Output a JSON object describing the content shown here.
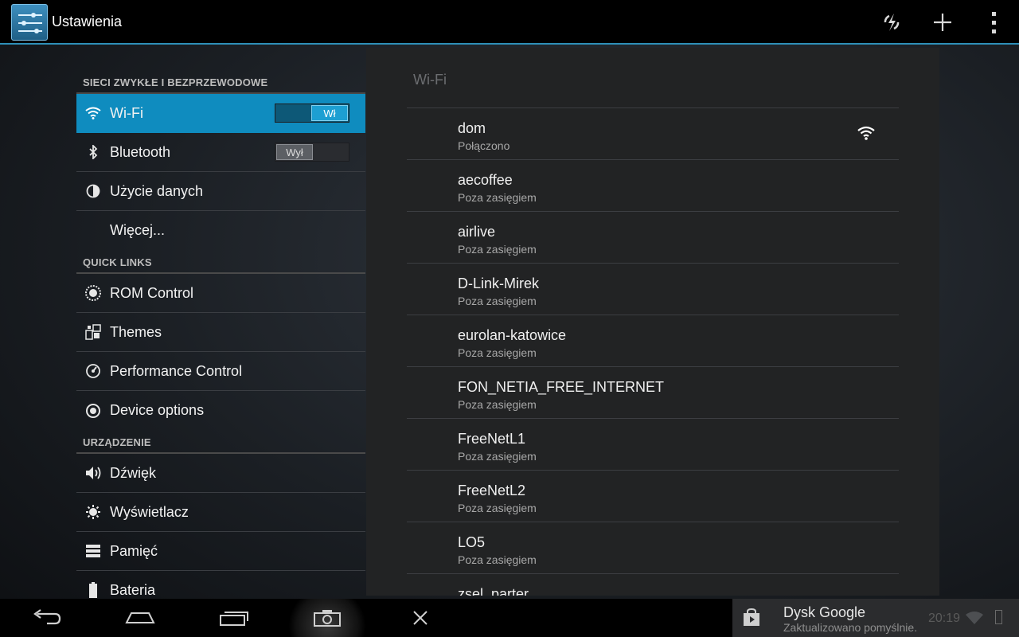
{
  "app": {
    "title": "Ustawienia"
  },
  "actionbar": {
    "refresh_icon": "refresh-icon",
    "add_icon": "add-icon",
    "menu_icon": "overflow-menu-icon"
  },
  "sidebar": {
    "sections": [
      {
        "header": "SIECI ZWYKŁE I BEZPRZEWODOWE",
        "items": [
          {
            "label": "Wi-Fi",
            "icon": "wifi-icon",
            "toggle": "Wł",
            "toggle_state": "on",
            "selected": true
          },
          {
            "label": "Bluetooth",
            "icon": "bluetooth-icon",
            "toggle": "Wył",
            "toggle_state": "off"
          },
          {
            "label": "Użycie danych",
            "icon": "data-usage-icon"
          },
          {
            "label": "Więcej...",
            "icon": ""
          }
        ]
      },
      {
        "header": "QUICK LINKS",
        "items": [
          {
            "label": "ROM Control",
            "icon": "rom-control-icon"
          },
          {
            "label": "Themes",
            "icon": "themes-icon"
          },
          {
            "label": "Performance Control",
            "icon": "performance-icon"
          },
          {
            "label": "Device options",
            "icon": "device-options-icon"
          }
        ]
      },
      {
        "header": "URZĄDZENIE",
        "items": [
          {
            "label": "Dźwięk",
            "icon": "sound-icon"
          },
          {
            "label": "Wyświetlacz",
            "icon": "display-icon"
          },
          {
            "label": "Pamięć",
            "icon": "storage-icon"
          },
          {
            "label": "Bateria",
            "icon": "battery-icon"
          }
        ]
      }
    ]
  },
  "wifi_panel": {
    "title": "Wi-Fi",
    "networks": [
      {
        "name": "dom",
        "status": "Połączono",
        "signal": true
      },
      {
        "name": "aecoffee",
        "status": "Poza zasięgiem"
      },
      {
        "name": "airlive",
        "status": "Poza zasięgiem"
      },
      {
        "name": "D-Link-Mirek",
        "status": "Poza zasięgiem"
      },
      {
        "name": "eurolan-katowice",
        "status": "Poza zasięgiem"
      },
      {
        "name": "FON_NETIA_FREE_INTERNET",
        "status": "Poza zasięgiem"
      },
      {
        "name": "FreeNetL1",
        "status": "Poza zasięgiem"
      },
      {
        "name": "FreeNetL2",
        "status": "Poza zasięgiem"
      },
      {
        "name": "LO5",
        "status": "Poza zasięgiem"
      },
      {
        "name": "zsel_parter",
        "status": ""
      }
    ]
  },
  "navbar": {
    "back_icon": "back-icon",
    "home_icon": "home-icon",
    "recent_icon": "recent-apps-icon",
    "screenshot_icon": "camera-icon",
    "close_icon": "close-icon"
  },
  "notification": {
    "title": "Dysk Google",
    "subtitle": "Zaktualizowano pomyślnie.",
    "time": "20:19"
  }
}
